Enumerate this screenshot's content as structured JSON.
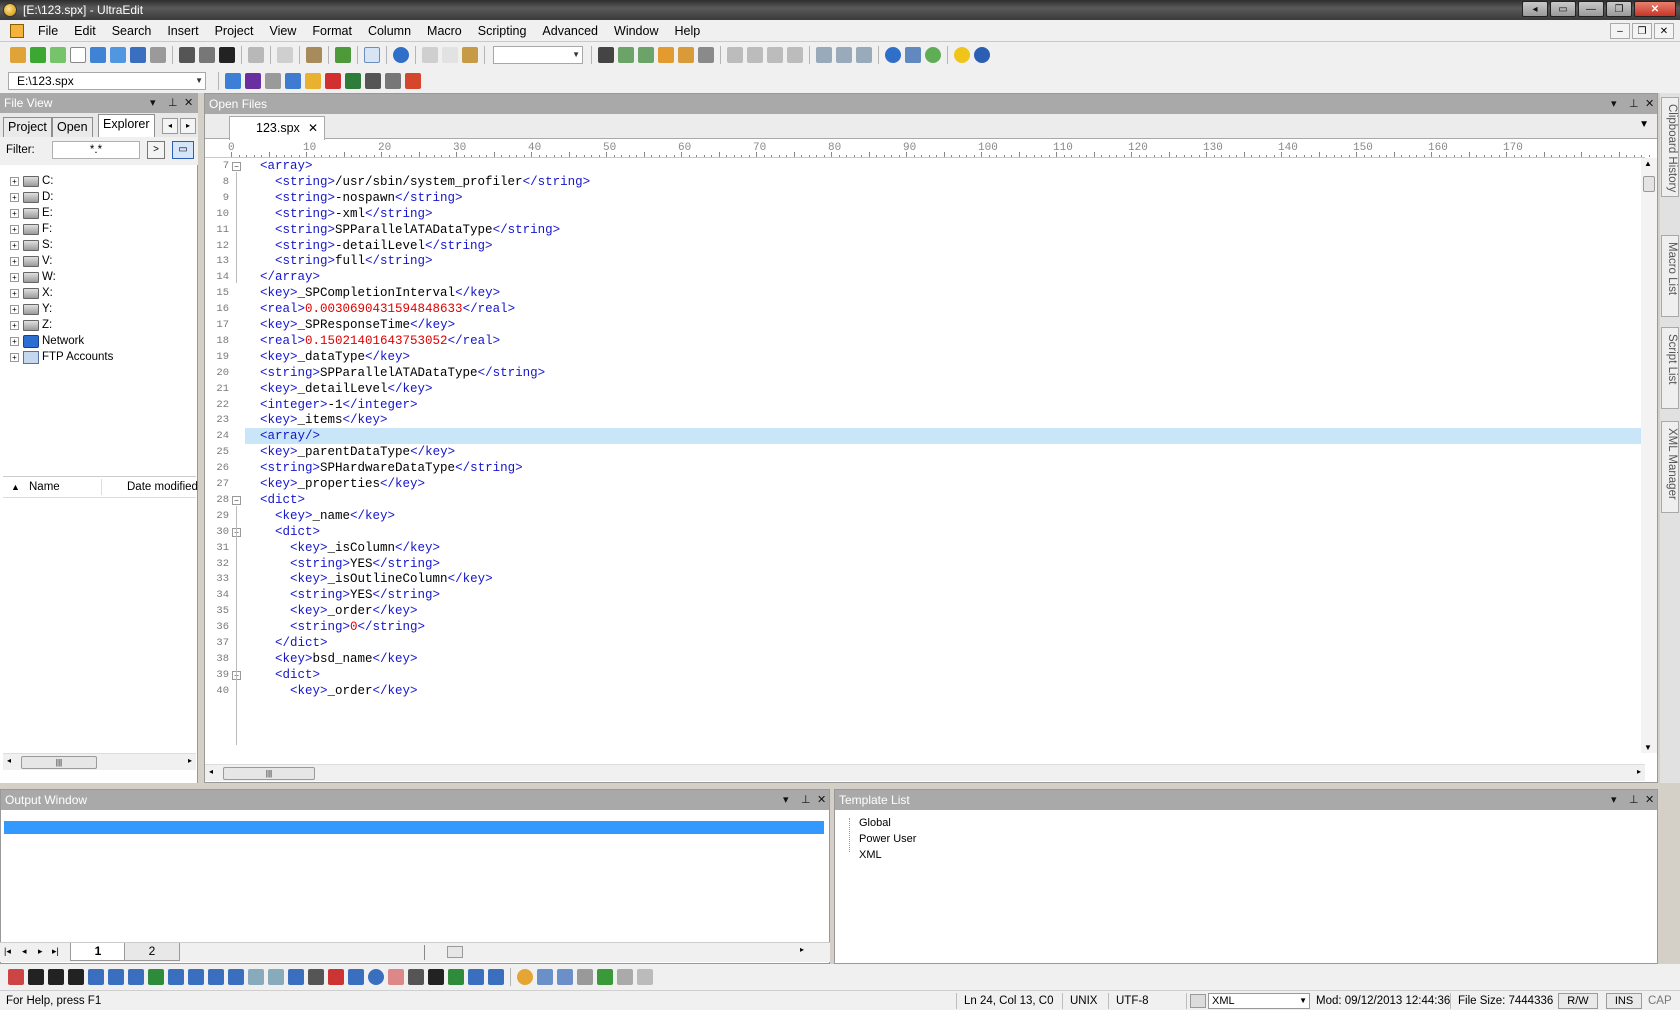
{
  "window": {
    "title": "[E:\\123.spx] - UltraEdit"
  },
  "menu": [
    "File",
    "Edit",
    "Search",
    "Insert",
    "Project",
    "View",
    "Format",
    "Column",
    "Macro",
    "Scripting",
    "Advanced",
    "Window",
    "Help"
  ],
  "toolbar2": {
    "file_combo": "E:\\123.spx"
  },
  "file_view": {
    "title": "File View",
    "tabs": [
      "Project",
      "Open",
      "Explorer"
    ],
    "active_tab": "Explorer",
    "filter_label": "Filter:",
    "filter_value": "*.*",
    "tree": [
      {
        "label": "C:",
        "icon": "drive-icon"
      },
      {
        "label": "D:",
        "icon": "drive-icon"
      },
      {
        "label": "E:",
        "icon": "drive-icon"
      },
      {
        "label": "F:",
        "icon": "drive-icon"
      },
      {
        "label": "S:",
        "icon": "network-drive-icon"
      },
      {
        "label": "V:",
        "icon": "network-drive-icon"
      },
      {
        "label": "W:",
        "icon": "network-drive-icon"
      },
      {
        "label": "X:",
        "icon": "network-drive-icon"
      },
      {
        "label": "Y:",
        "icon": "network-drive-icon"
      },
      {
        "label": "Z:",
        "icon": "network-drive-icon"
      },
      {
        "label": "Network",
        "icon": "network-icon"
      },
      {
        "label": "FTP Accounts",
        "icon": "ftp-icon"
      }
    ],
    "columns": [
      "Name",
      "Date modified"
    ]
  },
  "open_files": {
    "title": "Open Files",
    "tab": "123.spx",
    "ruler": [
      "0",
      "10",
      "20",
      "30",
      "40",
      "50",
      "60",
      "70",
      "80",
      "90",
      "100",
      "110",
      "120",
      "130",
      "140",
      "150",
      "160",
      "170"
    ],
    "lines": [
      {
        "n": "7",
        "indent": "  ",
        "parts": [
          [
            "t",
            "<array>"
          ]
        ]
      },
      {
        "n": "8",
        "indent": "    ",
        "parts": [
          [
            "t",
            "<string>"
          ],
          [
            "p",
            "/usr/sbin/system_profiler"
          ],
          [
            "t",
            "</string>"
          ]
        ]
      },
      {
        "n": "9",
        "indent": "    ",
        "parts": [
          [
            "t",
            "<string>"
          ],
          [
            "p",
            "-nospawn"
          ],
          [
            "t",
            "</string>"
          ]
        ]
      },
      {
        "n": "10",
        "indent": "    ",
        "parts": [
          [
            "t",
            "<string>"
          ],
          [
            "p",
            "-xml"
          ],
          [
            "t",
            "</string>"
          ]
        ]
      },
      {
        "n": "11",
        "indent": "    ",
        "parts": [
          [
            "t",
            "<string>"
          ],
          [
            "p",
            "SPParallelATADataType"
          ],
          [
            "t",
            "</string>"
          ]
        ]
      },
      {
        "n": "12",
        "indent": "    ",
        "parts": [
          [
            "t",
            "<string>"
          ],
          [
            "p",
            "-detailLevel"
          ],
          [
            "t",
            "</string>"
          ]
        ]
      },
      {
        "n": "13",
        "indent": "    ",
        "parts": [
          [
            "t",
            "<string>"
          ],
          [
            "p",
            "full"
          ],
          [
            "t",
            "</string>"
          ]
        ]
      },
      {
        "n": "14",
        "indent": "  ",
        "parts": [
          [
            "t",
            "</array>"
          ]
        ]
      },
      {
        "n": "15",
        "indent": "  ",
        "parts": [
          [
            "t",
            "<key>"
          ],
          [
            "p",
            "_SPCompletionInterval"
          ],
          [
            "t",
            "</key>"
          ]
        ]
      },
      {
        "n": "16",
        "indent": "  ",
        "parts": [
          [
            "t",
            "<real>"
          ],
          [
            "n",
            "0.0030690431594848633"
          ],
          [
            "t",
            "</real>"
          ]
        ]
      },
      {
        "n": "17",
        "indent": "  ",
        "parts": [
          [
            "t",
            "<key>"
          ],
          [
            "p",
            "_SPResponseTime"
          ],
          [
            "t",
            "</key>"
          ]
        ]
      },
      {
        "n": "18",
        "indent": "  ",
        "parts": [
          [
            "t",
            "<real>"
          ],
          [
            "n",
            "0.15021401643753052"
          ],
          [
            "t",
            "</real>"
          ]
        ]
      },
      {
        "n": "19",
        "indent": "  ",
        "parts": [
          [
            "t",
            "<key>"
          ],
          [
            "p",
            "_dataType"
          ],
          [
            "t",
            "</key>"
          ]
        ]
      },
      {
        "n": "20",
        "indent": "  ",
        "parts": [
          [
            "t",
            "<string>"
          ],
          [
            "p",
            "SPParallelATADataType"
          ],
          [
            "t",
            "</string>"
          ]
        ]
      },
      {
        "n": "21",
        "indent": "  ",
        "parts": [
          [
            "t",
            "<key>"
          ],
          [
            "p",
            "_detailLevel"
          ],
          [
            "t",
            "</key>"
          ]
        ]
      },
      {
        "n": "22",
        "indent": "  ",
        "parts": [
          [
            "t",
            "<integer>"
          ],
          [
            "p",
            "-1"
          ],
          [
            "t",
            "</integer>"
          ]
        ]
      },
      {
        "n": "23",
        "indent": "  ",
        "parts": [
          [
            "t",
            "<key>"
          ],
          [
            "p",
            "_items"
          ],
          [
            "t",
            "</key>"
          ]
        ]
      },
      {
        "n": "24",
        "indent": "  ",
        "parts": [
          [
            "t",
            "<array/>"
          ]
        ],
        "hl": true
      },
      {
        "n": "25",
        "indent": "  ",
        "parts": [
          [
            "t",
            "<key>"
          ],
          [
            "p",
            "_parentDataType"
          ],
          [
            "t",
            "</key>"
          ]
        ]
      },
      {
        "n": "26",
        "indent": "  ",
        "parts": [
          [
            "t",
            "<string>"
          ],
          [
            "p",
            "SPHardwareDataType"
          ],
          [
            "t",
            "</string>"
          ]
        ]
      },
      {
        "n": "27",
        "indent": "  ",
        "parts": [
          [
            "t",
            "<key>"
          ],
          [
            "p",
            "_properties"
          ],
          [
            "t",
            "</key>"
          ]
        ]
      },
      {
        "n": "28",
        "indent": "  ",
        "parts": [
          [
            "t",
            "<dict>"
          ]
        ]
      },
      {
        "n": "29",
        "indent": "    ",
        "parts": [
          [
            "t",
            "<key>"
          ],
          [
            "p",
            "_name"
          ],
          [
            "t",
            "</key>"
          ]
        ]
      },
      {
        "n": "30",
        "indent": "    ",
        "parts": [
          [
            "t",
            "<dict>"
          ]
        ]
      },
      {
        "n": "31",
        "indent": "      ",
        "parts": [
          [
            "t",
            "<key>"
          ],
          [
            "p",
            "_isColumn"
          ],
          [
            "t",
            "</key>"
          ]
        ]
      },
      {
        "n": "32",
        "indent": "      ",
        "parts": [
          [
            "t",
            "<string>"
          ],
          [
            "p",
            "YES"
          ],
          [
            "t",
            "</string>"
          ]
        ]
      },
      {
        "n": "33",
        "indent": "      ",
        "parts": [
          [
            "t",
            "<key>"
          ],
          [
            "p",
            "_isOutlineColumn"
          ],
          [
            "t",
            "</key>"
          ]
        ]
      },
      {
        "n": "34",
        "indent": "      ",
        "parts": [
          [
            "t",
            "<string>"
          ],
          [
            "p",
            "YES"
          ],
          [
            "t",
            "</string>"
          ]
        ]
      },
      {
        "n": "35",
        "indent": "      ",
        "parts": [
          [
            "t",
            "<key>"
          ],
          [
            "p",
            "_order"
          ],
          [
            "t",
            "</key>"
          ]
        ]
      },
      {
        "n": "36",
        "indent": "      ",
        "parts": [
          [
            "t",
            "<string>"
          ],
          [
            "n",
            "0"
          ],
          [
            "t",
            "</string>"
          ]
        ]
      },
      {
        "n": "37",
        "indent": "    ",
        "parts": [
          [
            "t",
            "</dict>"
          ]
        ]
      },
      {
        "n": "38",
        "indent": "    ",
        "parts": [
          [
            "t",
            "<key>"
          ],
          [
            "p",
            "bsd_name"
          ],
          [
            "t",
            "</key>"
          ]
        ]
      },
      {
        "n": "39",
        "indent": "    ",
        "parts": [
          [
            "t",
            "<dict>"
          ]
        ]
      },
      {
        "n": "40",
        "indent": "      ",
        "parts": [
          [
            "t",
            "<key>"
          ],
          [
            "p",
            "_order"
          ],
          [
            "t",
            "</key>"
          ]
        ]
      }
    ]
  },
  "side_tabs": [
    "Clipboard History",
    "Macro List",
    "Script List",
    "XML Manager"
  ],
  "output": {
    "title": "Output Window",
    "sheets": [
      "1",
      "2"
    ]
  },
  "template_list": {
    "title": "Template List",
    "items": [
      "Global",
      "Power User",
      "XML"
    ]
  },
  "status": {
    "help": "For Help, press F1",
    "position": "Ln 24, Col 13, C0",
    "line_ending": "UNIX",
    "encoding": "UTF-8",
    "highlighting": "XML",
    "modified": "Mod: 09/12/2013 12:44:36",
    "file_size": "File Size: 7444336",
    "rw": "R/W",
    "ins": "INS",
    "cap": "CAP"
  },
  "colors": {
    "tag": "#1515cc",
    "number": "#e00000",
    "highlight_line": "#c8e6f8",
    "selection": "#3399ff"
  }
}
